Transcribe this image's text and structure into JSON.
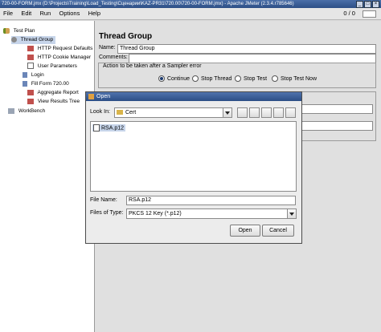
{
  "window": {
    "title": "720-00-FORM.jmx (D:\\Projects\\Training\\Load_Testing\\Сценарии\\KAZ-PR31\\720.00\\720-00-FORM.jmx) - Apache JMeter (2.3.4.r785646)"
  },
  "menu": {
    "file": "File",
    "edit": "Edit",
    "run": "Run",
    "options": "Options",
    "help": "Help",
    "counts": "0 / 0"
  },
  "tree": {
    "items": [
      {
        "label": "Test Plan",
        "icon": "test-plan-icon"
      },
      {
        "label": "Thread Group",
        "icon": "thread-group-icon"
      },
      {
        "label": "HTTP Request Defaults",
        "icon": "config-icon"
      },
      {
        "label": "HTTP Cookie Manager",
        "icon": "config-icon"
      },
      {
        "label": "User Parameters",
        "icon": "preprocessor-icon"
      },
      {
        "label": "Login",
        "icon": "controller-icon"
      },
      {
        "label": "Fill Form 720.00",
        "icon": "controller-icon"
      },
      {
        "label": "Aggregate Report",
        "icon": "listener-icon"
      },
      {
        "label": "View Results Tree",
        "icon": "listener-icon"
      },
      {
        "label": "WorkBench",
        "icon": "workbench-icon"
      }
    ]
  },
  "panel": {
    "title": "Thread Group",
    "name_label": "Name:",
    "name_value": "Thread Group",
    "comments_label": "Comments:",
    "action_label": "Action to be taken after a Sampler error",
    "options": [
      "Continue",
      "Stop Thread",
      "Stop Test",
      "Stop Test Now"
    ],
    "selected": "Continue"
  },
  "dialog": {
    "title": "Open",
    "lookin_label": "Look In:",
    "lookin_value": "Cert",
    "files": [
      "RSA.p12"
    ],
    "filename_label": "File Name:",
    "filename_value": "RSA.p12",
    "filetype_label": "Files of Type:",
    "filetype_value": "PKCS 12 Key (*.p12)",
    "open_button": "Open",
    "cancel_button": "Cancel"
  },
  "colors": {
    "titlebar": "#2d4f86",
    "selection": "#c7d5ea"
  }
}
